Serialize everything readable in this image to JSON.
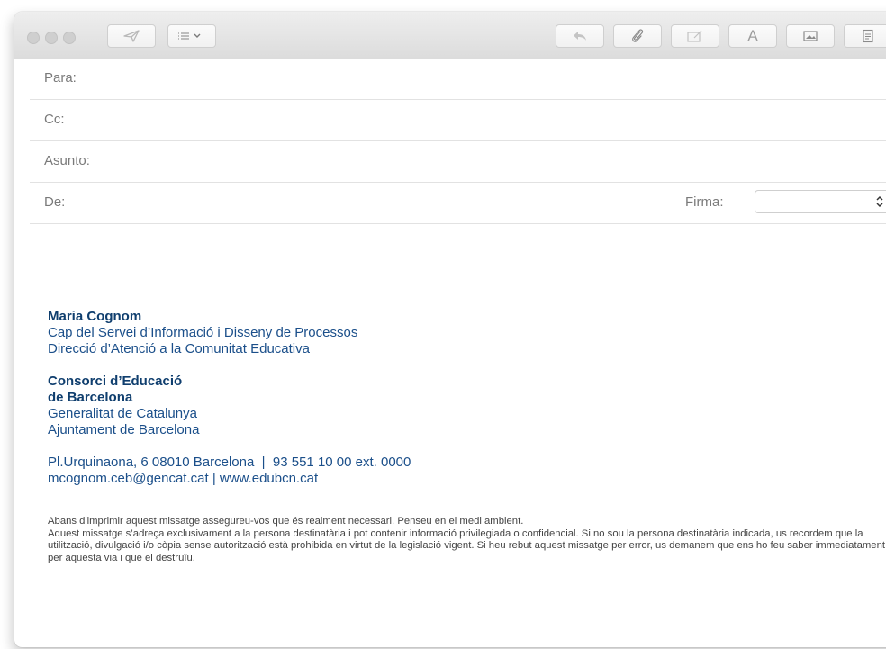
{
  "toolbar": {
    "icons": [
      "close-icon",
      "minimize-icon",
      "zoom-icon",
      "send-icon",
      "list-menu-icon",
      "reply-icon",
      "attach-icon",
      "compose-icon",
      "font-icon",
      "photo-icon",
      "format-icon"
    ],
    "font_glyph": "A"
  },
  "headers": {
    "to_label": "Para:",
    "cc_label": "Cc:",
    "subject_label": "Asunto:",
    "from_label": "De:",
    "signature_label": "Firma:",
    "signature_value": ""
  },
  "signature": {
    "name": "Maria Cognom",
    "role": "Cap del Servei d’Informació i Disseny de Processos",
    "department": "Direcció d’Atenció a la Comunitat Educativa",
    "org_line1": "Consorci d’Educació",
    "org_line2": "de Barcelona",
    "affiliation1": "Generalitat de Catalunya",
    "affiliation2": "Ajuntament de Barcelona",
    "address": "Pl.Urquinaona, 6 08010 Barcelona  |  93 551 10 00 ext. 0000",
    "contact": "mcognom.ceb@gencat.cat | www.edubcn.cat"
  },
  "disclaimer": {
    "line1": "Abans d'imprimir aquest missatge assegureu-vos que és realment necessari. Penseu en el medi ambient.",
    "line2": "Aquest missatge s’adreça exclusivament a la persona destinatària i pot contenir informació privilegiada o confidencial. Si no sou la persona destinatària indicada, us recordem que la utilització, divulgació i/o còpia sense autorització està prohibida en virtut de la legislació vigent. Si heu rebut aquest missatge per error, us demanem que ens ho feu saber immediatament per aquesta via i que el destruïu."
  },
  "colors": {
    "signature_blue": "#1b4f8a",
    "toolbar_bg": "#e4e4e4",
    "label_gray": "#7a7a7a"
  }
}
